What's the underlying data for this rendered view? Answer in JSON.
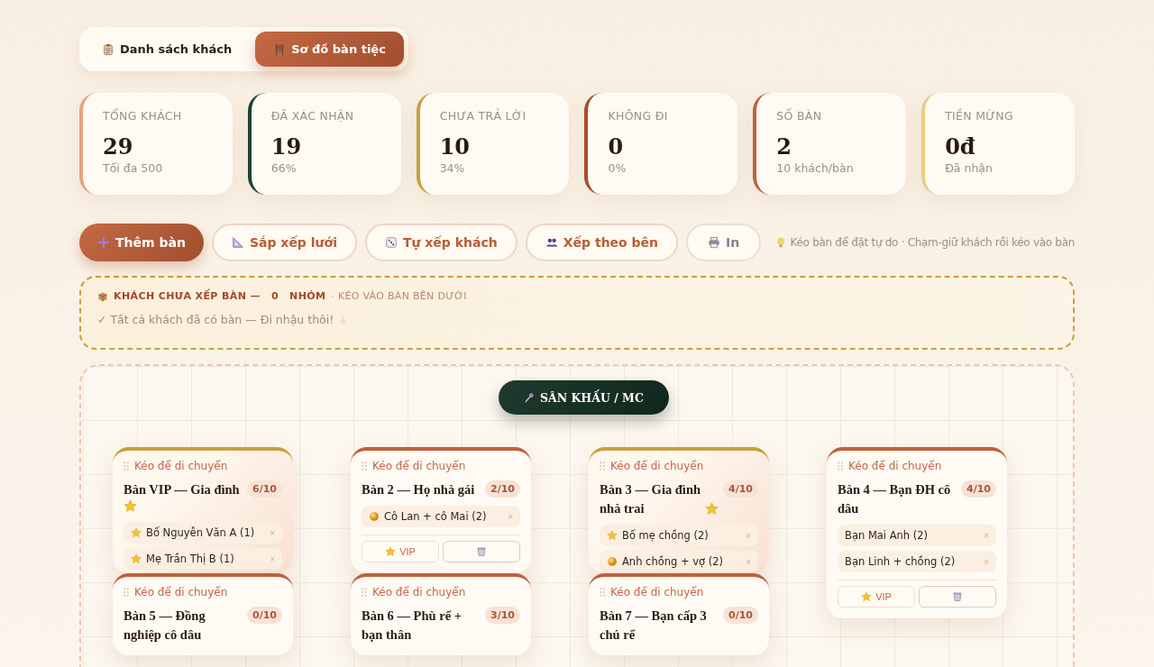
{
  "tabs": [
    {
      "label": "Danh sách khách",
      "selected": false
    },
    {
      "label": "Sơ đồ bàn tiệc",
      "selected": true
    }
  ],
  "stats": [
    {
      "label": "TỔNG KHÁCH",
      "value": "29",
      "note": "Tối đa 500",
      "color": "#e8a182"
    },
    {
      "label": "ĐÃ XÁC NHẬN",
      "value": "19",
      "note": "66%",
      "color": "#1e4030"
    },
    {
      "label": "CHƯA TRẢ LỜI",
      "value": "10",
      "note": "34%",
      "color": "#c9a03c"
    },
    {
      "label": "KHÔNG ĐI",
      "value": "0",
      "note": "0%",
      "color": "#a84a2a"
    },
    {
      "label": "SỐ BÀN",
      "value": "2",
      "note": "10 khách/bàn",
      "color": "#c0603a"
    },
    {
      "label": "TIỀN MỪNG",
      "value": "0đ",
      "note": "Đã nhận",
      "color": "#e6cd84"
    }
  ],
  "toolbar": [
    {
      "label": "Thêm bàn",
      "kind": "primary"
    },
    {
      "label": "Sắp xếp lưới",
      "kind": "outline"
    },
    {
      "label": "Tự xếp khách",
      "kind": "outline"
    },
    {
      "label": "Xếp theo bên",
      "kind": "outline"
    },
    {
      "label": "In",
      "kind": "neutral"
    }
  ],
  "hint": "Kéo bàn để đặt tự do · Chạm-giữ khách rồi kéo vào bàn",
  "unseated": {
    "title": "KHÁCH CHƯA XẾP BÀN —",
    "count": "0",
    "unit": "NHÓM",
    "subtitle": "· KÉO VÀO BÀN BÊN DƯỚI",
    "message": "✓ Tất cả khách đã có bàn — Đi nhậu thôi!"
  },
  "stage": "SÂN KHẤU / MC",
  "tables": [
    {
      "drag": "Kéo để di chuyển",
      "name": "Bàn VIP — Gia đình",
      "vip": true,
      "count": "6/10",
      "guests": [
        {
          "name": "Bố Nguyễn Văn A (1)",
          "kind": "star",
          "remove": "×"
        },
        {
          "name": "Mẹ Trần Thị B (1)",
          "kind": "star",
          "remove": "×"
        }
      ]
    },
    {
      "drag": "Kéo để di chuyển",
      "name": "Bàn 2 — Họ nhà gái",
      "vip": false,
      "count": "2/10",
      "guests": [
        {
          "name": "Cô Lan + cô Mai (2)",
          "kind": "dot",
          "remove": "×"
        }
      ],
      "vip_button": "VIP"
    },
    {
      "drag": "Kéo để di chuyển",
      "name": "Bàn 3 — Gia đình nhà trai",
      "vip": true,
      "count": "4/10",
      "guests": [
        {
          "name": "Bố mẹ chồng (2)",
          "kind": "star",
          "remove": "×"
        },
        {
          "name": "Anh chồng + vợ (2)",
          "kind": "dot",
          "remove": "×"
        }
      ]
    },
    {
      "drag": "Kéo để di chuyển",
      "name": "Bàn 4 — Bạn ĐH cô dâu",
      "vip": false,
      "count": "4/10",
      "guests": [
        {
          "name": "Bạn Mai Anh (2)",
          "kind": "plain",
          "remove": "×"
        },
        {
          "name": "Bạn Linh + chồng (2)",
          "kind": "plain",
          "remove": "×"
        }
      ],
      "vip_button": "VIP"
    },
    {
      "drag": "Kéo để di chuyển",
      "name": "Bàn 5 — Đồng nghiệp cô dâu",
      "vip": false,
      "count": "0/10"
    },
    {
      "drag": "Kéo để di chuyển",
      "name": "Bàn 6 — Phù rể + bạn thân",
      "vip": false,
      "count": "3/10"
    },
    {
      "drag": "Kéo để di chuyển",
      "name": "Bàn 7 — Bạn cấp 3 chú rể",
      "vip": false,
      "count": "0/10"
    }
  ]
}
